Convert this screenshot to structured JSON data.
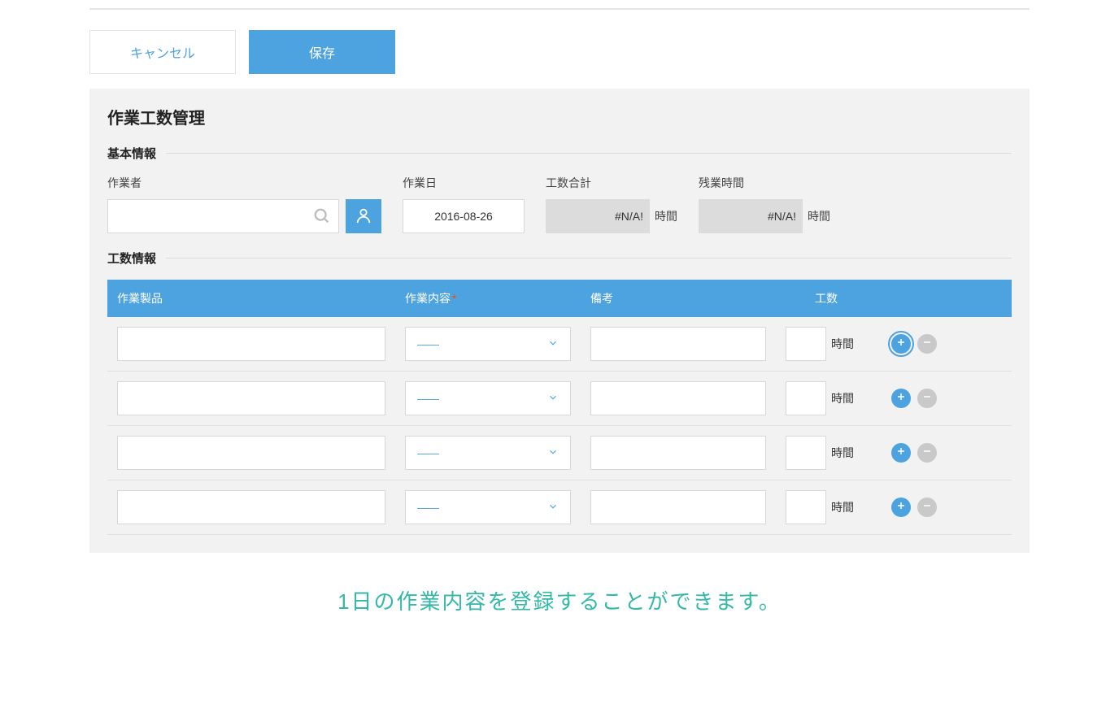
{
  "buttons": {
    "cancel_label": "キャンセル",
    "save_label": "保存"
  },
  "panel": {
    "title": "作業工数管理"
  },
  "sections": {
    "basic_info_label": "基本情報",
    "hours_info_label": "工数情報"
  },
  "fields": {
    "worker_label": "作業者",
    "work_date_label": "作業日",
    "work_date_value": "2016-08-26",
    "total_label": "工数合計",
    "total_value": "#N/A!",
    "overtime_label": "残業時間",
    "overtime_value": "#N/A!",
    "unit_label": "時間"
  },
  "table": {
    "headers": {
      "product": "作業製品",
      "content": "作業内容",
      "note": "備考",
      "hours": "工数"
    },
    "select_placeholder": "——",
    "row_unit": "時間",
    "rows": [
      {
        "product": "",
        "content": "",
        "note": "",
        "hours": "",
        "highlight_add": true
      },
      {
        "product": "",
        "content": "",
        "note": "",
        "hours": "",
        "highlight_add": false
      },
      {
        "product": "",
        "content": "",
        "note": "",
        "hours": "",
        "highlight_add": false
      },
      {
        "product": "",
        "content": "",
        "note": "",
        "hours": "",
        "highlight_add": false
      }
    ]
  },
  "caption": "1日の作業内容を登録することができます。"
}
